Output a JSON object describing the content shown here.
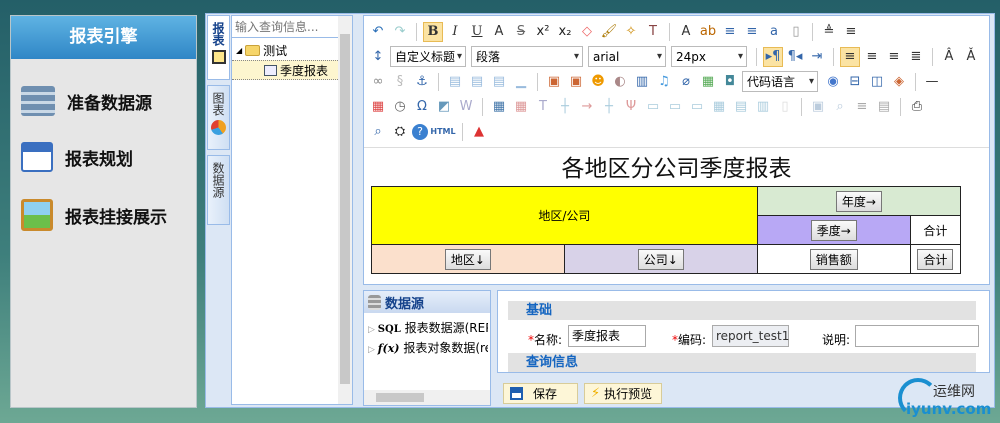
{
  "left_panel": {
    "title": "报表引擎",
    "items": [
      {
        "label": "准备数据源",
        "icon": "database-cart-icon"
      },
      {
        "label": "报表规划",
        "icon": "calendar-grid-icon"
      },
      {
        "label": "报表挂接展示",
        "icon": "easel-icon"
      }
    ]
  },
  "vtabs": [
    {
      "label": "报表",
      "active": true
    },
    {
      "label": "图表"
    },
    {
      "label": "数据源"
    }
  ],
  "tree": {
    "search_placeholder": "输入查询信息...",
    "folder": "测试",
    "leaf": "季度报表"
  },
  "toolbar": {
    "rows": [
      [
        "undo",
        "redo",
        "|",
        "bold",
        "italic",
        "underline",
        "font-border",
        "strikethrough",
        "superscript",
        "subscript",
        "eraser",
        "format-brush",
        "auto-format",
        "paste-text",
        "|",
        "font-color",
        "highlight",
        "ordered-list",
        "unordered-list",
        "text-box",
        "blank-page",
        "|",
        "line-height-up",
        "line-height-down"
      ],
      [
        "row-spacing",
        "SEL:custom_title",
        "SEL:paragraph",
        "SEL:font",
        "SEL:size",
        "|",
        "ltr",
        "rtl",
        "indent",
        "|",
        "align-left",
        "align-center",
        "align-right",
        "justify",
        "|",
        "font-larger",
        "font-smaller"
      ],
      [
        "link",
        "unlink",
        "anchor",
        "|",
        "img-left",
        "img-none",
        "img-center",
        "img-right",
        "|",
        "image",
        "multi-image",
        "emoticon",
        "scrawl",
        "video",
        "music",
        "attachment",
        "map",
        "gmap",
        "SEL:code_lang",
        "web-app",
        "page-break",
        "template",
        "background",
        "|",
        "horizontal-rule"
      ],
      [
        "date",
        "time",
        "special-char",
        "snap",
        "word-image",
        "|",
        "insert-table",
        "delete-table",
        "table-title",
        "insert-row",
        "delete-row",
        "insert-col",
        "delete-col",
        "merge-cells",
        "merge-right",
        "merge-down",
        "split-cells",
        "split-rows",
        "split-cols",
        "cell-props",
        "|",
        "edit-image",
        "search-replace",
        "select-all",
        "clear",
        "|",
        "print"
      ],
      [
        "preview",
        "find",
        "help",
        "html",
        "|",
        "chart"
      ]
    ],
    "selects": {
      "custom_title": "自定义标题",
      "paragraph": "段落",
      "font": "arial",
      "size": "24px",
      "code_lang": "代码语言"
    },
    "active": [
      "bold",
      "ltr",
      "align-left"
    ]
  },
  "report": {
    "title": "各地区分公司季度报表",
    "cells": {
      "region_company": "地区/公司",
      "year": "年度→",
      "quarter": "季度→",
      "total_header": "合计",
      "region": "地区↓",
      "company": "公司↓",
      "sales": "销售额",
      "total": "合计"
    },
    "colors": {
      "yellow": "#ffff00",
      "green": "#d8ead2",
      "purple": "#b8a8f5",
      "peach": "#fbe0cc",
      "lavender": "#d8d2e8"
    }
  },
  "datasource": {
    "title": "数据源",
    "items": [
      {
        "prefix": "SQL",
        "label": "报表数据源(REPORT_TEST)"
      },
      {
        "prefix": "f(x)",
        "label": "报表对象数据(report)"
      }
    ]
  },
  "form": {
    "section_basic": "基础",
    "name_label": "名称:",
    "name_value": "季度报表",
    "code_label": "编码:",
    "code_value": "report_test1",
    "desc_label": "说明:",
    "desc_value": "",
    "section_query": "查询信息",
    "required_mark": "*"
  },
  "actions": {
    "save": "保存",
    "preview": "执行预览"
  },
  "watermark": {
    "text": "运维网",
    "domain": "iyunv.com"
  }
}
